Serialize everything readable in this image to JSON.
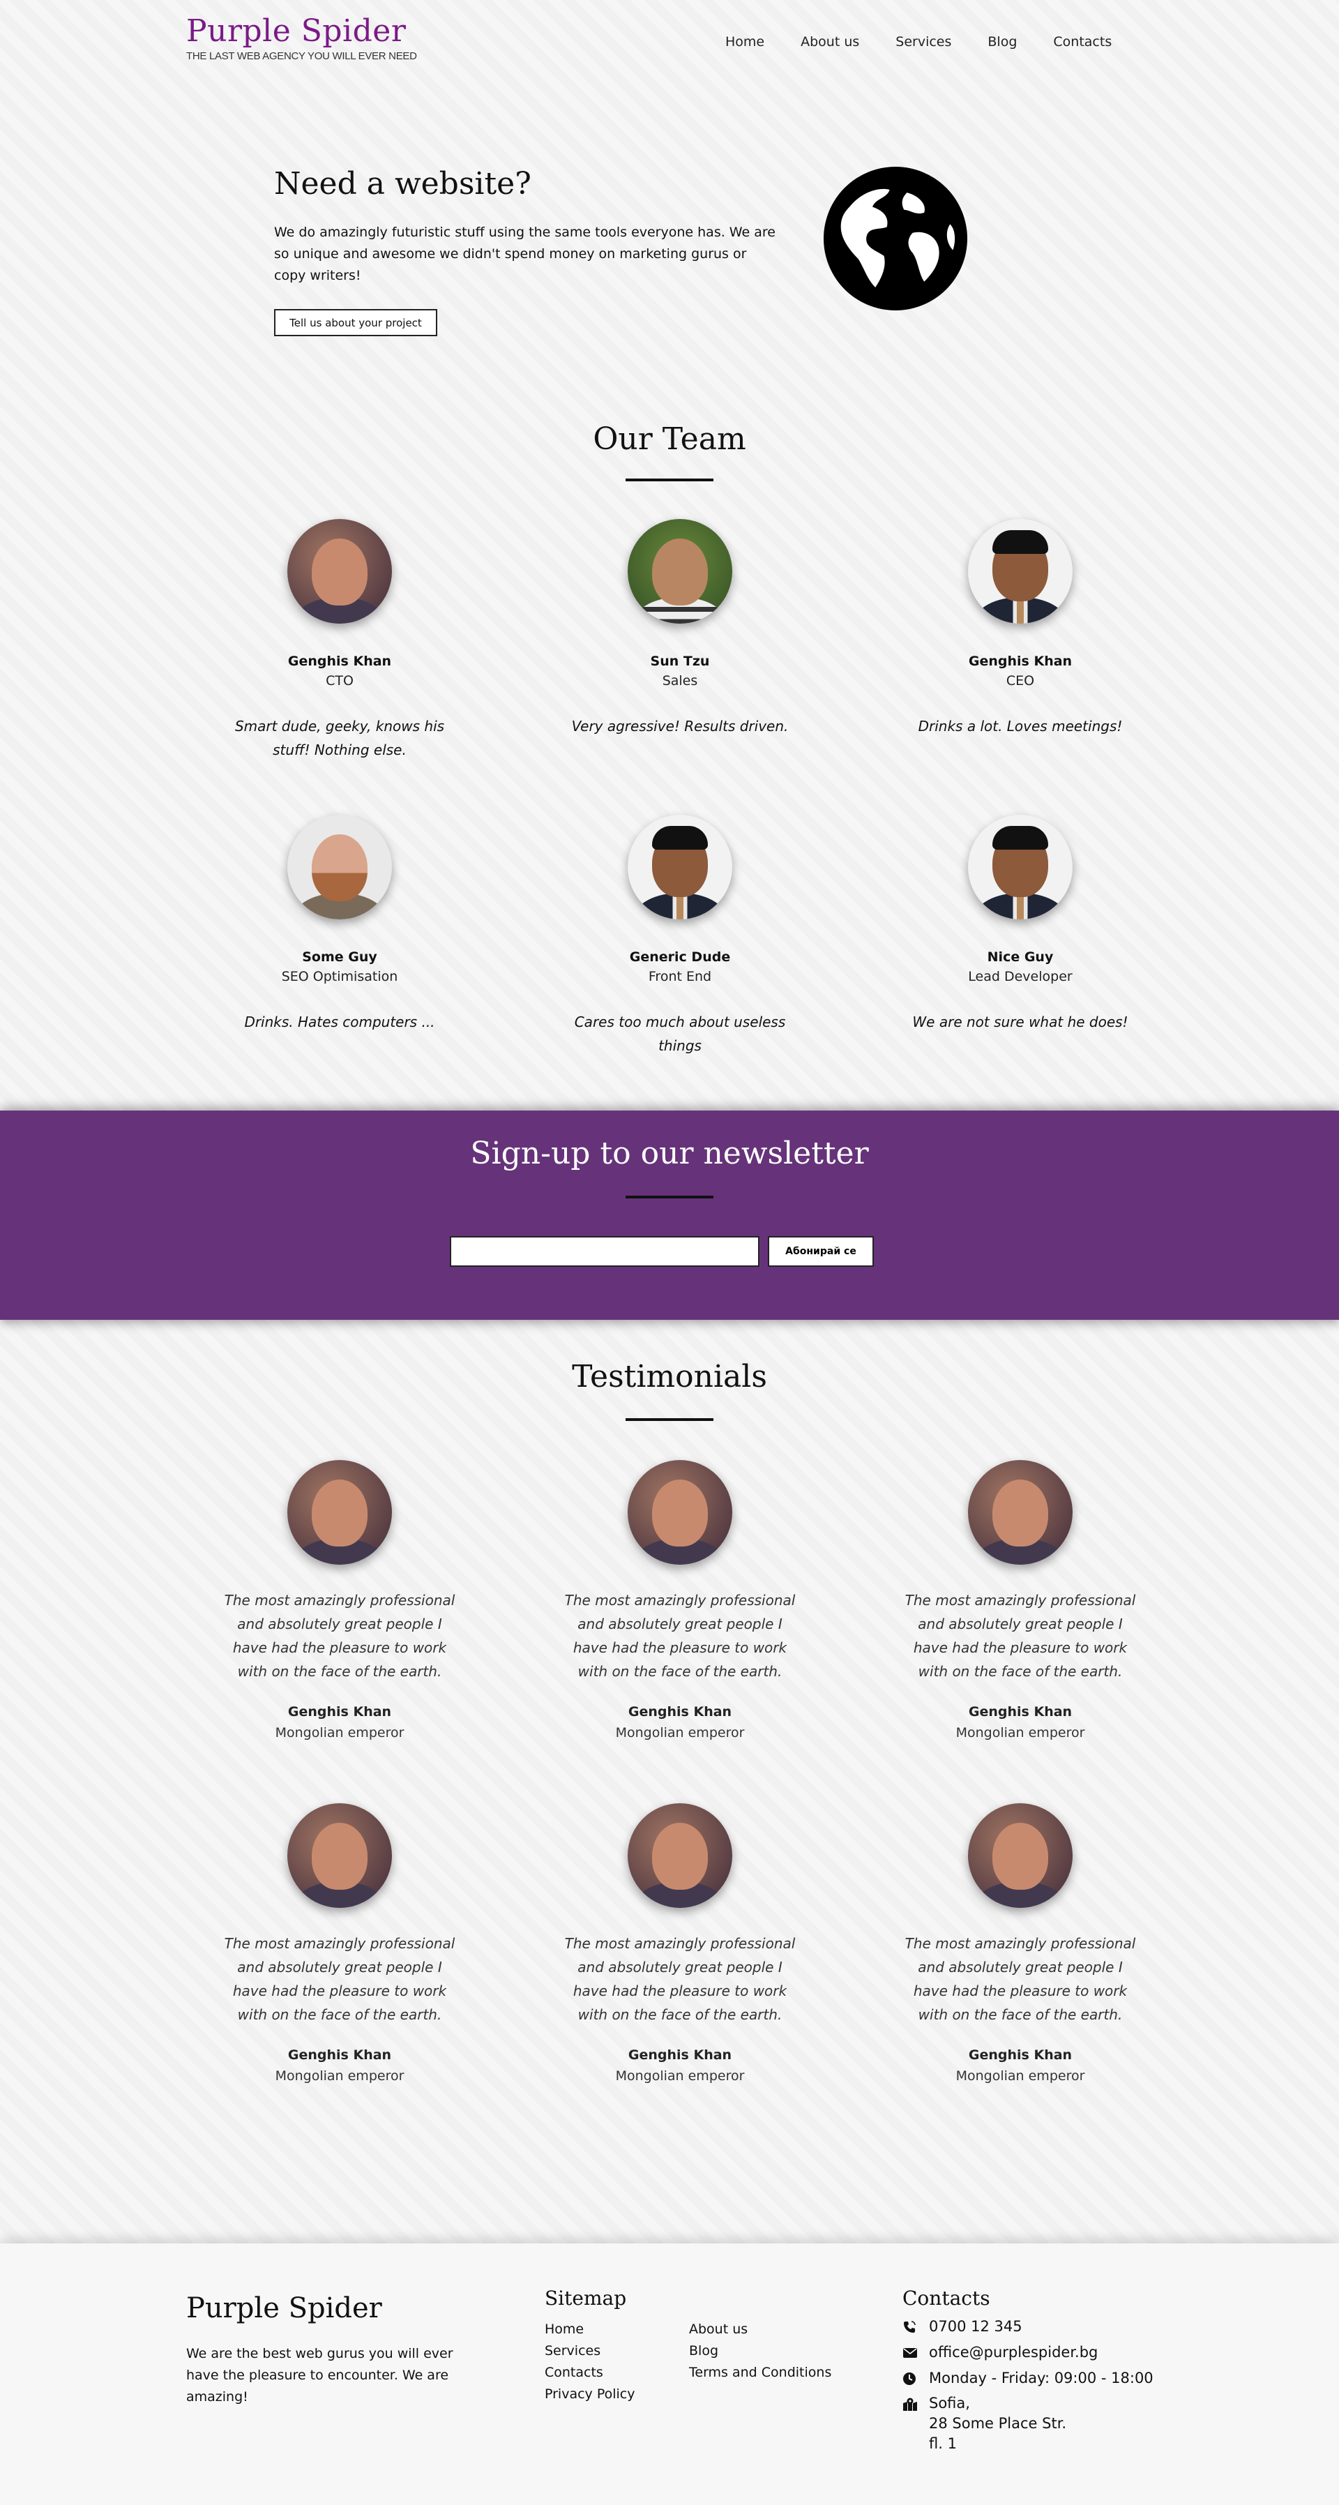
{
  "header": {
    "logo_title": "Purple Spider",
    "logo_tagline": "THE LAST WEB AGENCY YOU WILL EVER NEED",
    "nav": [
      "Home",
      "About us",
      "Services",
      "Blog",
      "Contacts"
    ]
  },
  "hero": {
    "title": "Need a website?",
    "text": "We do amazingly futuristic stuff using the same tools everyone has. We are so unique and awesome we didn't spend money on marketing gurus or copy writers!",
    "button": "Tell us about your project",
    "icon": "globe-icon"
  },
  "team": {
    "title": "Our Team",
    "members": [
      {
        "name": "Genghis Khan",
        "role": "CTO",
        "quote": "Smart dude, geeky, knows his stuff! Nothing else."
      },
      {
        "name": "Sun Tzu",
        "role": "Sales",
        "quote": "Very agressive! Results driven."
      },
      {
        "name": "Genghis Khan",
        "role": "CEO",
        "quote": "Drinks a lot. Loves meetings!"
      },
      {
        "name": "Some Guy",
        "role": "SEO Optimisation",
        "quote": "Drinks. Hates computers ..."
      },
      {
        "name": "Generic Dude",
        "role": "Front End",
        "quote": "Cares too much about useless things"
      },
      {
        "name": "Nice Guy",
        "role": "Lead Developer",
        "quote": "We are not sure what he does!"
      }
    ]
  },
  "newsletter": {
    "title": "Sign-up to our newsletter",
    "input_value": "",
    "button": "Абонирай се",
    "background_color": "#66337a"
  },
  "testimonials": {
    "title": "Testimonials",
    "items": [
      {
        "quote": "The most amazingly professional and absolutely great people I have had the pleasure to work with on the face of the earth.",
        "name": "Genghis Khan",
        "role": "Mongolian emperor"
      },
      {
        "quote": "The most amazingly professional and absolutely great people I have had the pleasure to work with on the face of the earth.",
        "name": "Genghis Khan",
        "role": "Mongolian emperor"
      },
      {
        "quote": "The most amazingly professional and absolutely great people I have had the pleasure to work with on the face of the earth.",
        "name": "Genghis Khan",
        "role": "Mongolian emperor"
      },
      {
        "quote": "The most amazingly professional and absolutely great people I have had the pleasure to work with on the face of the earth.",
        "name": "Genghis Khan",
        "role": "Mongolian emperor"
      },
      {
        "quote": "The most amazingly professional and absolutely great people I have had the pleasure to work with on the face of the earth.",
        "name": "Genghis Khan",
        "role": "Mongolian emperor"
      },
      {
        "quote": "The most amazingly professional and absolutely great people I have had the pleasure to work with on the face of the earth.",
        "name": "Genghis Khan",
        "role": "Mongolian emperor"
      }
    ]
  },
  "footer": {
    "brand": "Purple Spider",
    "about": "We are the best web gurus you will ever have the pleasure to encounter. We are amazing!",
    "sitemap_title": "Sitemap",
    "sitemap_col1": [
      "Home",
      "Services",
      "Contacts",
      "Privacy Policy"
    ],
    "sitemap_col2": [
      "About us",
      "Blog",
      "Terms and Conditions"
    ],
    "contacts_title": "Contacts",
    "phone": "0700 12 345",
    "email": "office@purplespider.bg",
    "hours": "Monday - Friday: 09:00 - 18:00",
    "address_line1": "Sofia,",
    "address_line2": "28 Some Place Str.",
    "address_line3": "fl. 1"
  },
  "colors": {
    "brand": "#7a1a86",
    "newsletter_bg": "#66337a"
  }
}
